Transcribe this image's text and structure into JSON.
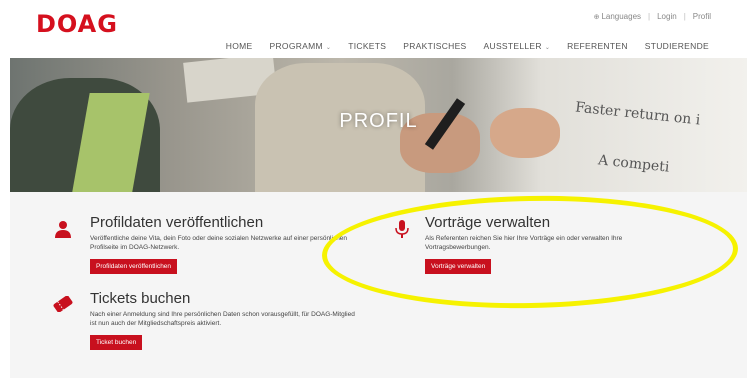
{
  "header": {
    "logo": "DOAG",
    "utility": {
      "languages": "Languages",
      "login": "Login",
      "profile": "Profil"
    },
    "nav": [
      {
        "label": "HOME",
        "dropdown": false
      },
      {
        "label": "PROGRAMM",
        "dropdown": true
      },
      {
        "label": "TICKETS",
        "dropdown": false
      },
      {
        "label": "PRAKTISCHES",
        "dropdown": false
      },
      {
        "label": "AUSSTELLER",
        "dropdown": true
      },
      {
        "label": "REFERENTEN",
        "dropdown": false
      },
      {
        "label": "STUDIERENDE",
        "dropdown": false
      }
    ]
  },
  "hero": {
    "title": "PROFIL",
    "banner_lines": [
      "Faster return on i",
      "A competi"
    ]
  },
  "features": {
    "profile": {
      "title": "Profildaten veröffentlichen",
      "text": "Veröffentliche deine Vita, dein Foto oder deine sozialen Netzwerke auf einer persönlichen Profilseite im DOAG-Netzwerk.",
      "button": "Profildaten veröffentlichen"
    },
    "talks": {
      "title": "Vorträge verwalten",
      "text": "Als Referenten reichen Sie hier Ihre Vorträge ein oder verwalten Ihre Vortragsbewerbungen.",
      "button": "Vorträge verwalten"
    },
    "tickets": {
      "title": "Tickets buchen",
      "text": "Nach einer Anmeldung sind Ihre persönlichen Daten schon vorausgefüllt, für DOAG-Mitglied ist nun auch der Mitgliedschaftspreis aktiviert.",
      "button": "Ticket buchen"
    }
  },
  "colors": {
    "brand": "#d5101e",
    "button": "#c8101e",
    "highlight": "#f6f200"
  },
  "icons": [
    "globe-icon",
    "user-icon",
    "microphone-icon",
    "ticket-icon",
    "chevron-down-icon"
  ]
}
